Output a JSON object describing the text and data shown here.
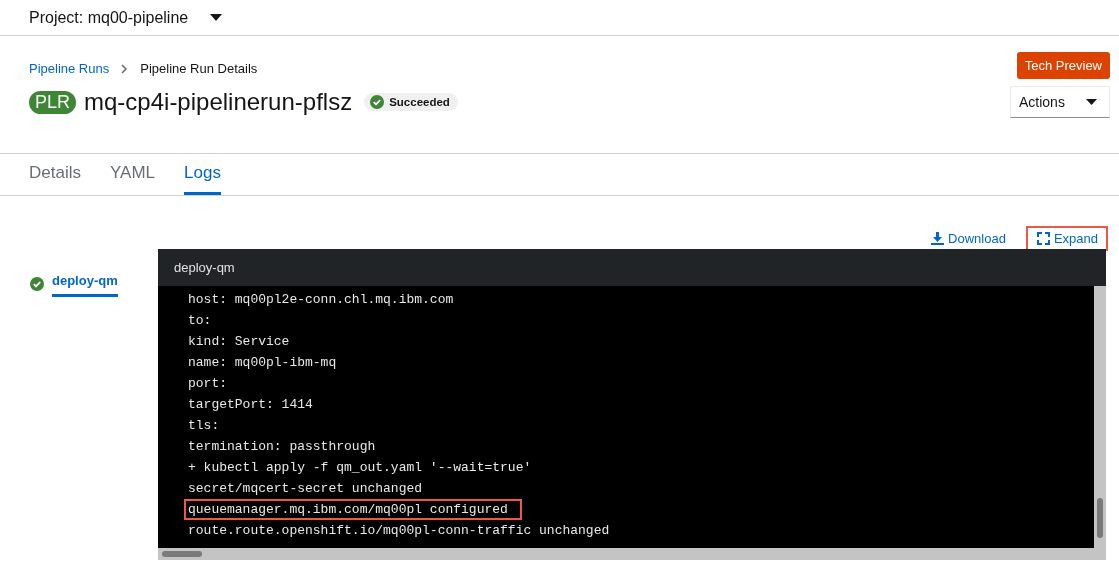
{
  "project": {
    "label": "Project: mq00-pipeline"
  },
  "breadcrumbs": [
    {
      "label": "Pipeline Runs",
      "kind": "link"
    },
    {
      "label": "Pipeline Run Details",
      "kind": "current"
    }
  ],
  "header": {
    "badge": "PLR",
    "title": "mq-cp4i-pipelinerun-pflsz",
    "status": "Succeeded",
    "tech_preview": "Tech Preview",
    "actions": "Actions"
  },
  "tabs": [
    {
      "label": "Details",
      "selected": false
    },
    {
      "label": "YAML",
      "selected": false
    },
    {
      "label": "Logs",
      "selected": true
    }
  ],
  "log_toolbar": [
    {
      "label": "Download",
      "kind": "download",
      "highlighted": false
    },
    {
      "label": "Expand",
      "kind": "expand",
      "highlighted": true
    }
  ],
  "tasks": [
    {
      "label": "deploy-qm",
      "selected": true
    }
  ],
  "log": {
    "title": "deploy-qm",
    "lines": [
      {
        "text": "host: mq00pl2e-conn.chl.mq.ibm.com",
        "highlighted": false
      },
      {
        "text": "to:",
        "highlighted": false
      },
      {
        "text": "kind: Service",
        "highlighted": false
      },
      {
        "text": "name: mq00pl-ibm-mq",
        "highlighted": false
      },
      {
        "text": "port:",
        "highlighted": false
      },
      {
        "text": "targetPort: 1414",
        "highlighted": false
      },
      {
        "text": "tls:",
        "highlighted": false
      },
      {
        "text": "termination: passthrough",
        "highlighted": false
      },
      {
        "text": "+ kubectl apply -f qm_out.yaml '--wait=true'",
        "highlighted": false
      },
      {
        "text": "secret/mqcert-secret unchanged",
        "highlighted": false
      },
      {
        "text": "queuemanager.mq.ibm.com/mq00pl configured",
        "highlighted": true
      },
      {
        "text": "route.route.openshift.io/mq00pl-conn-traffic unchanged",
        "highlighted": false
      }
    ]
  }
}
